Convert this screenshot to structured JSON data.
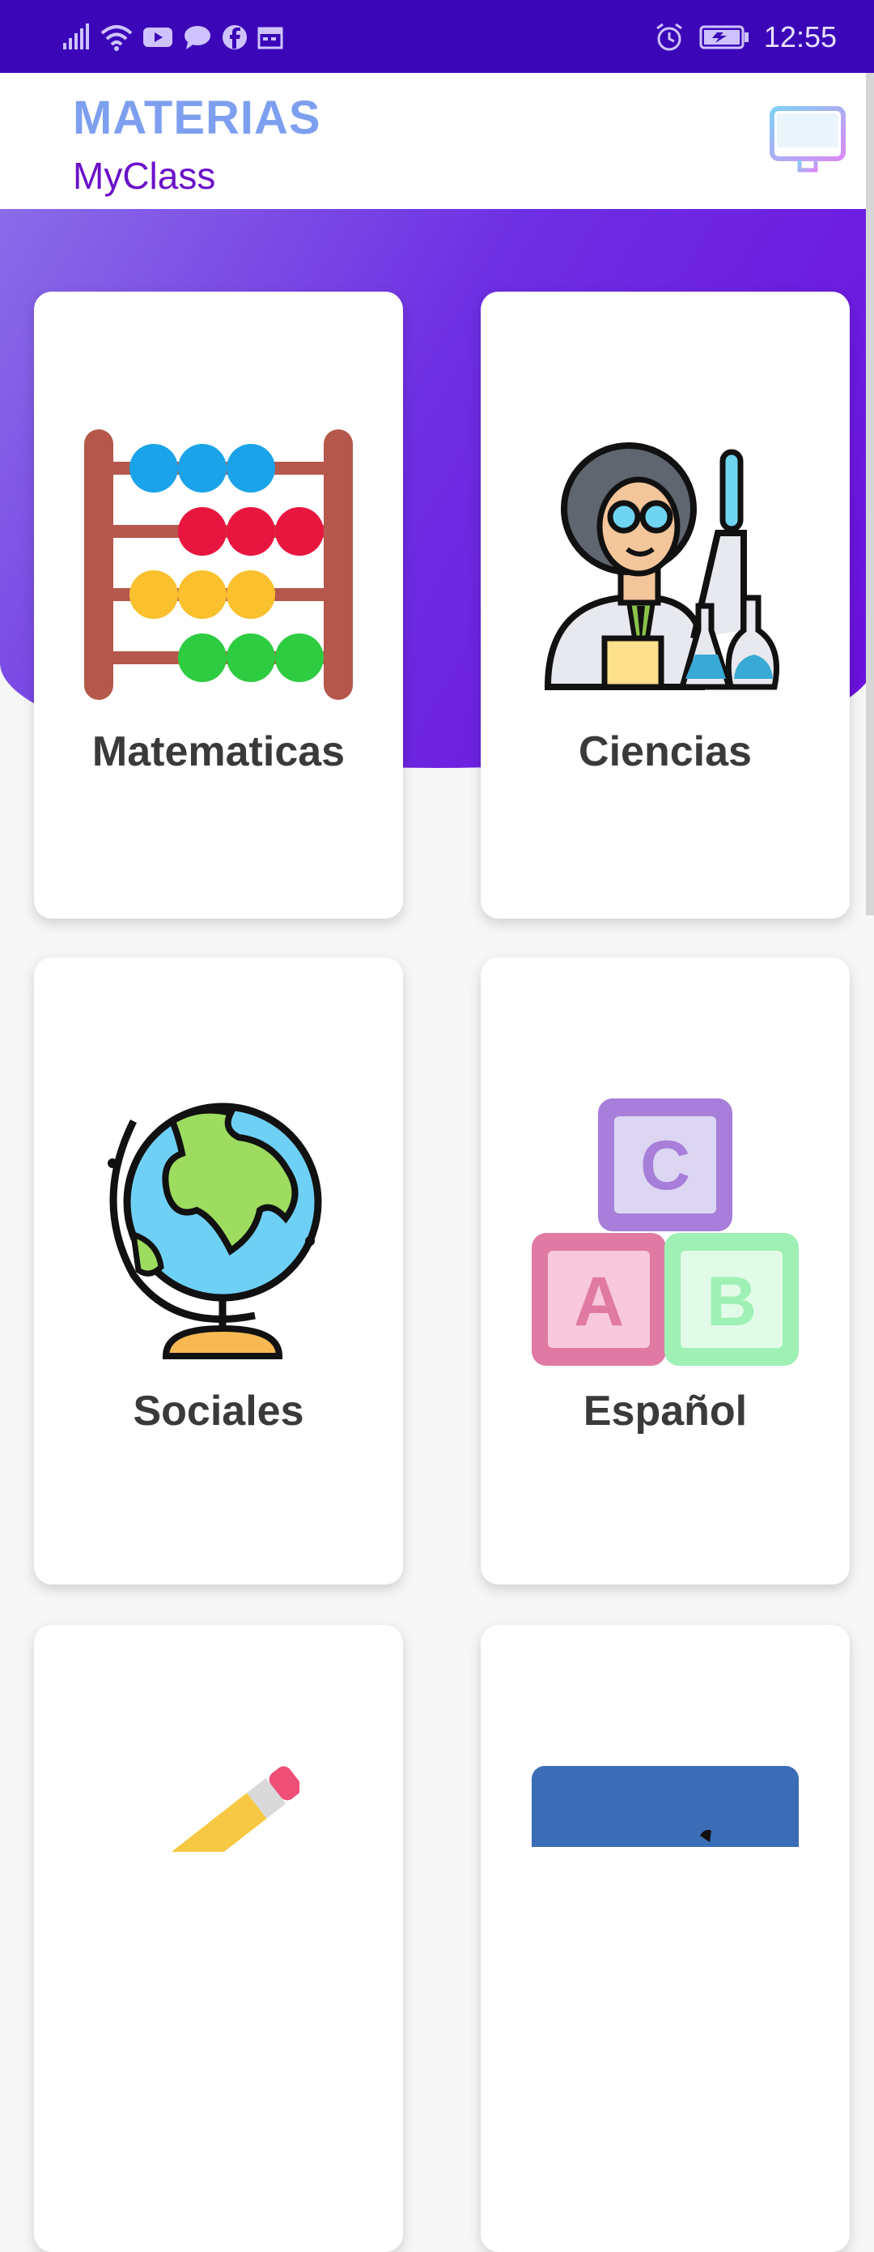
{
  "status_bar": {
    "time": "12:55",
    "icons_left": [
      "signal-icon",
      "wifi-icon",
      "youtube-icon",
      "chat-icon",
      "facebook-icon",
      "calendar-icon"
    ],
    "icons_right": [
      "alarm-icon",
      "battery-icon"
    ]
  },
  "header": {
    "title": "MATERIAS",
    "subtitle": "MyClass",
    "action_icon": "monitor-icon"
  },
  "colors": {
    "status_bar": "#3b06b8",
    "title": "#7e9ff0",
    "subtitle": "#6a12c9",
    "hero_start": "#8a6ce8",
    "hero_end": "#6a0edc"
  },
  "subjects": [
    {
      "label": "Matematicas",
      "icon": "abacus-icon"
    },
    {
      "label": "Ciencias",
      "icon": "scientist-icon"
    },
    {
      "label": "Sociales",
      "icon": "globe-icon"
    },
    {
      "label": "Español",
      "icon": "abc-blocks-icon"
    },
    {
      "label": "",
      "icon": "pencil-icon"
    },
    {
      "label": "",
      "icon": "blue-board-icon"
    }
  ]
}
